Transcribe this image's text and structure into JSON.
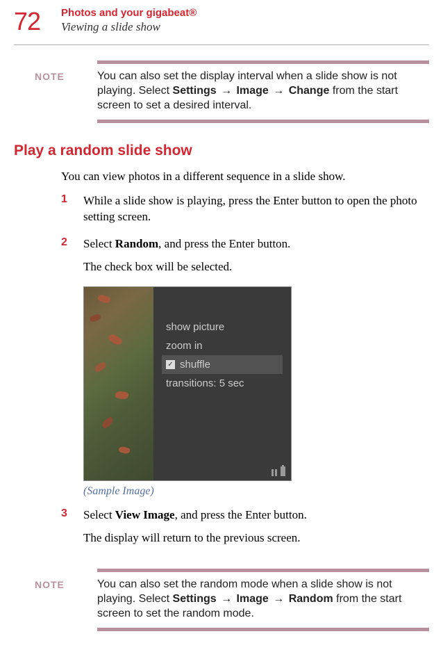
{
  "page_number": "72",
  "chapter": "Photos and your gigabeat®",
  "section": "Viewing a slide show",
  "note1": {
    "label": "NOTE",
    "pre": "You can also set the display interval when a slide show is not playing. Select ",
    "b1": "Settings",
    "arrow": "→",
    "b2": "Image",
    "b3": "Change",
    "post": " from the start screen to set a desired interval."
  },
  "subheading": "Play a random slide show",
  "intro": "You can view photos in a different sequence in a slide show.",
  "steps": {
    "s1": {
      "num": "1",
      "text": "While a slide show is playing, press the Enter button to open the photo setting screen."
    },
    "s2": {
      "num": "2",
      "pre": "Select ",
      "b": "Random",
      "post": ", and press the Enter button.",
      "follow": "The check box will be selected."
    },
    "s3": {
      "num": "3",
      "pre": "Select ",
      "b": "View Image",
      "post": ", and press the Enter button.",
      "follow": "The display will return to the previous screen."
    }
  },
  "screen": {
    "item1": "show picture",
    "item2": "zoom in",
    "item3": "shuffle",
    "item4": "transitions: 5 sec"
  },
  "caption": "(Sample Image)",
  "note2": {
    "label": "NOTE",
    "pre": "You can also set the random mode when a slide show is not playing. Select ",
    "b1": "Settings",
    "arrow": "→",
    "b2": "Image",
    "b3": "Random",
    "post": " from the start screen to set the random mode."
  }
}
